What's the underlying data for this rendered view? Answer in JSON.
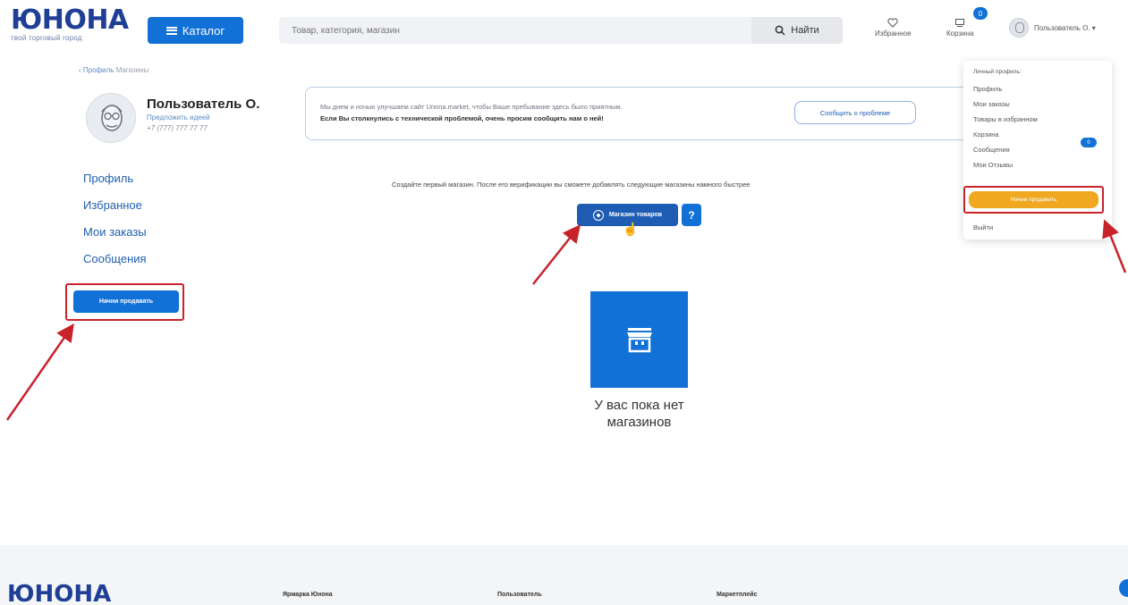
{
  "header": {
    "logo_main": "ЮНОНА",
    "logo_sub": "твой торговый город",
    "catalog_label": "Каталог",
    "search_placeholder": "Товар, категория, магазин",
    "search_button": "Найти",
    "favorites_label": "Избранное",
    "cart_label": "Корзина",
    "cart_count": "0",
    "user_label": "Пользователь О. ▾"
  },
  "breadcrumb": {
    "parent": "‹ Профиль",
    "current": "Магазины"
  },
  "profile": {
    "name": "Пользователь О.",
    "link": "Предложить идеей",
    "phone": "+7 (777) 777 77 77"
  },
  "sidebar": {
    "items": [
      {
        "label": "Профиль"
      },
      {
        "label": "Избранное"
      },
      {
        "label": "Мои заказы"
      },
      {
        "label": "Сообщения"
      }
    ],
    "sell_button": "Начни продавать"
  },
  "notice": {
    "line1": "Мы днем и ночью улучшаем сайт Unona.market, чтобы Ваше пребывание здесь было приятным.",
    "line2": "Если Вы столкнулись с технической проблемой, очень просим сообщить нам о ней!",
    "report_button": "Сообщить о проблеме"
  },
  "main": {
    "create_text": "Создайте первый магазин. После его верификации вы сможете добавлять следующие магазины намного быстрее",
    "add_shop_button": "Магазин товаров",
    "help_button": "?",
    "empty_line1": "У вас пока нет",
    "empty_line2": "магазинов"
  },
  "dropdown": {
    "header": "Личный профиль:",
    "items": [
      {
        "label": "Профиль"
      },
      {
        "label": "Мои заказы"
      },
      {
        "label": "Товары в избранном"
      },
      {
        "label": "Корзина"
      },
      {
        "label": "Сообщения"
      },
      {
        "label": "Мои Отзывы"
      }
    ],
    "cart_badge": "0",
    "sell_button": "Начни продавать",
    "logout": "Выйти"
  },
  "footer": {
    "logo": "ЮНОНА",
    "col1": "Ярмарка Юнона",
    "col2": "Пользователь",
    "col3": "Маркетплейс"
  },
  "colors": {
    "brand_blue": "#1271d6",
    "logo_navy": "#1f3f97",
    "highlight_red": "#c8232b",
    "sell_orange": "#f0a820"
  }
}
